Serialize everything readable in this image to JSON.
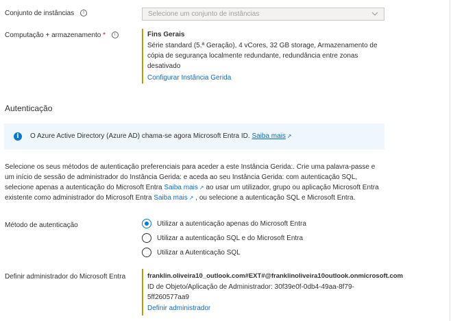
{
  "instance_pool": {
    "label": "Conjunto de instâncias",
    "placeholder": "Selecione um conjunto de instâncias",
    "info_icon": "info-icon"
  },
  "compute": {
    "label": "Computação + armazenamento",
    "required_mark": "*",
    "tier": "Fins Gerais",
    "details": "Série standard (5.ª Geração), 4 vCores, 32 GB storage, Armazenamento de cópia de segurança localmente redundante, redundância entre zonas desativado",
    "configure_link": "Configurar Instância Gerida"
  },
  "auth": {
    "section_title": "Autenticação",
    "banner_text": "O Azure Active Directory (Azure AD) chama-se agora Microsoft Entra ID.",
    "banner_link": "Saiba mais",
    "desc_part1": "Selecione os seus métodos de autenticação preferenciais para aceder a este Instância Gerida:. Crie uma palavra-passe e um início de sessão de administrador do Instância Gerida: e aceda ao seu Instância Gerida: com autenticação SQL, selecione apenas a autenticação do Microsoft Entra",
    "desc_link1": "Saiba mais",
    "desc_part2": "ao usar um utilizador, grupo ou aplicação Microsoft Entra existente como administrador do Microsoft Entra",
    "desc_link2": "Saiba mais",
    "desc_part3": ", ou selecione a autenticação SQL e Microsoft Entra.",
    "method_label": "Método de autenticação",
    "options": [
      {
        "label": "Utilizar a autenticação apenas do Microsoft Entra",
        "selected": true
      },
      {
        "label": "Utilizar a autenticação SQL e do Microsoft Entra",
        "selected": false
      },
      {
        "label": "Utilizar a Autenticação SQL",
        "selected": false
      }
    ],
    "admin_label": "Definir administrador do Microsoft Entra",
    "admin_name": "franklin.oliveira10_outlook.com#EXT#@franklinoliveira10outlook.onmicrosoft.com",
    "admin_id": "ID de Objeto/Aplicação de Administrador: 30f39e0f-0db4-49aa-8f79-5ff260577aa9",
    "admin_link": "Definir administrador"
  },
  "colors": {
    "link": "#0f6cbd",
    "accent_line": "#c19c00",
    "banner_bg": "#eff6fc",
    "radio_selected": "#0078d4"
  }
}
